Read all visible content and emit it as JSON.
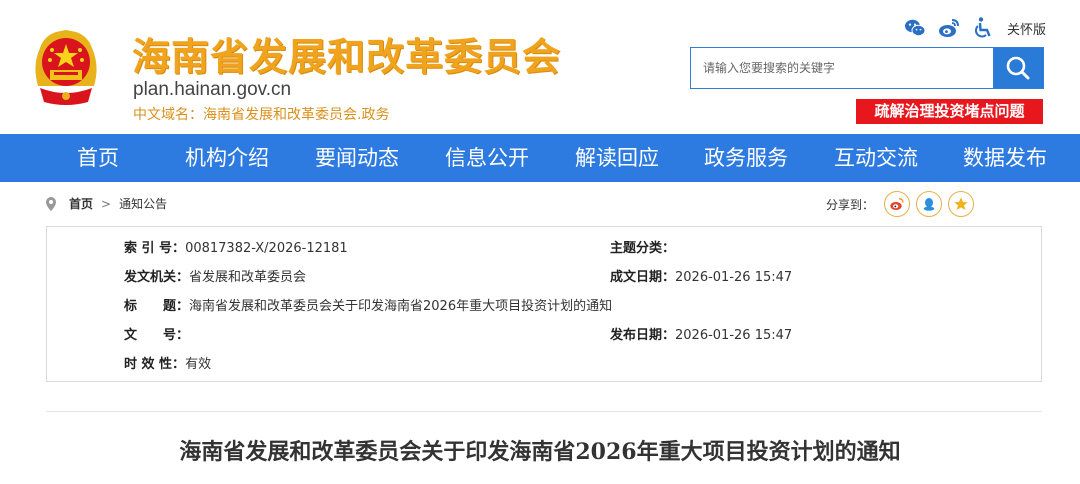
{
  "header": {
    "site_title": "海南省发展和改革委员会",
    "domain": "plan.hainan.gov.cn",
    "cn_domain": "中文域名：海南省发展和改革委员会.政务",
    "care_mode": "关怀版",
    "search_placeholder": "请输入您要搜索的关键字",
    "banner_link": "疏解治理投资堵点问题"
  },
  "nav": {
    "items": [
      "首页",
      "机构介绍",
      "要闻动态",
      "信息公开",
      "解读回应",
      "政务服务",
      "互动交流",
      "数据发布"
    ]
  },
  "breadcrumb": {
    "home": "首页",
    "separator": ">",
    "current": "通知公告"
  },
  "share": {
    "label": "分享到："
  },
  "meta": {
    "index_label": "索 引 号：",
    "index_value": "00817382-X/2026-12181",
    "topic_label": "主题分类：",
    "topic_value": "",
    "issuer_label": "发文机关：",
    "issuer_value": "省发展和改革委员会",
    "created_label": "成文日期：",
    "created_value": "2026-01-26 15:47",
    "title_label": "标　　题：",
    "title_value": "海南省发展和改革委员会关于印发海南省2026年重大项目投资计划的通知",
    "docno_label": "文　　号：",
    "docno_value": "",
    "published_label": "发布日期：",
    "published_value": "2026-01-26 15:47",
    "validity_label": "时 效 性：",
    "validity_value": "有效"
  },
  "document": {
    "title": "海南省发展和改革委员会关于印发海南省2026年重大项目投资计划的通知"
  },
  "colors": {
    "nav_blue": "#2d7be0",
    "title_gold": "#f0a31c",
    "banner_red": "#e8171d"
  },
  "icons": [
    "national-emblem-icon",
    "wechat-icon",
    "weibo-icon",
    "accessibility-icon",
    "search-icon",
    "location-pin-icon",
    "share-weibo-icon",
    "share-qq-icon",
    "share-favorite-icon"
  ]
}
